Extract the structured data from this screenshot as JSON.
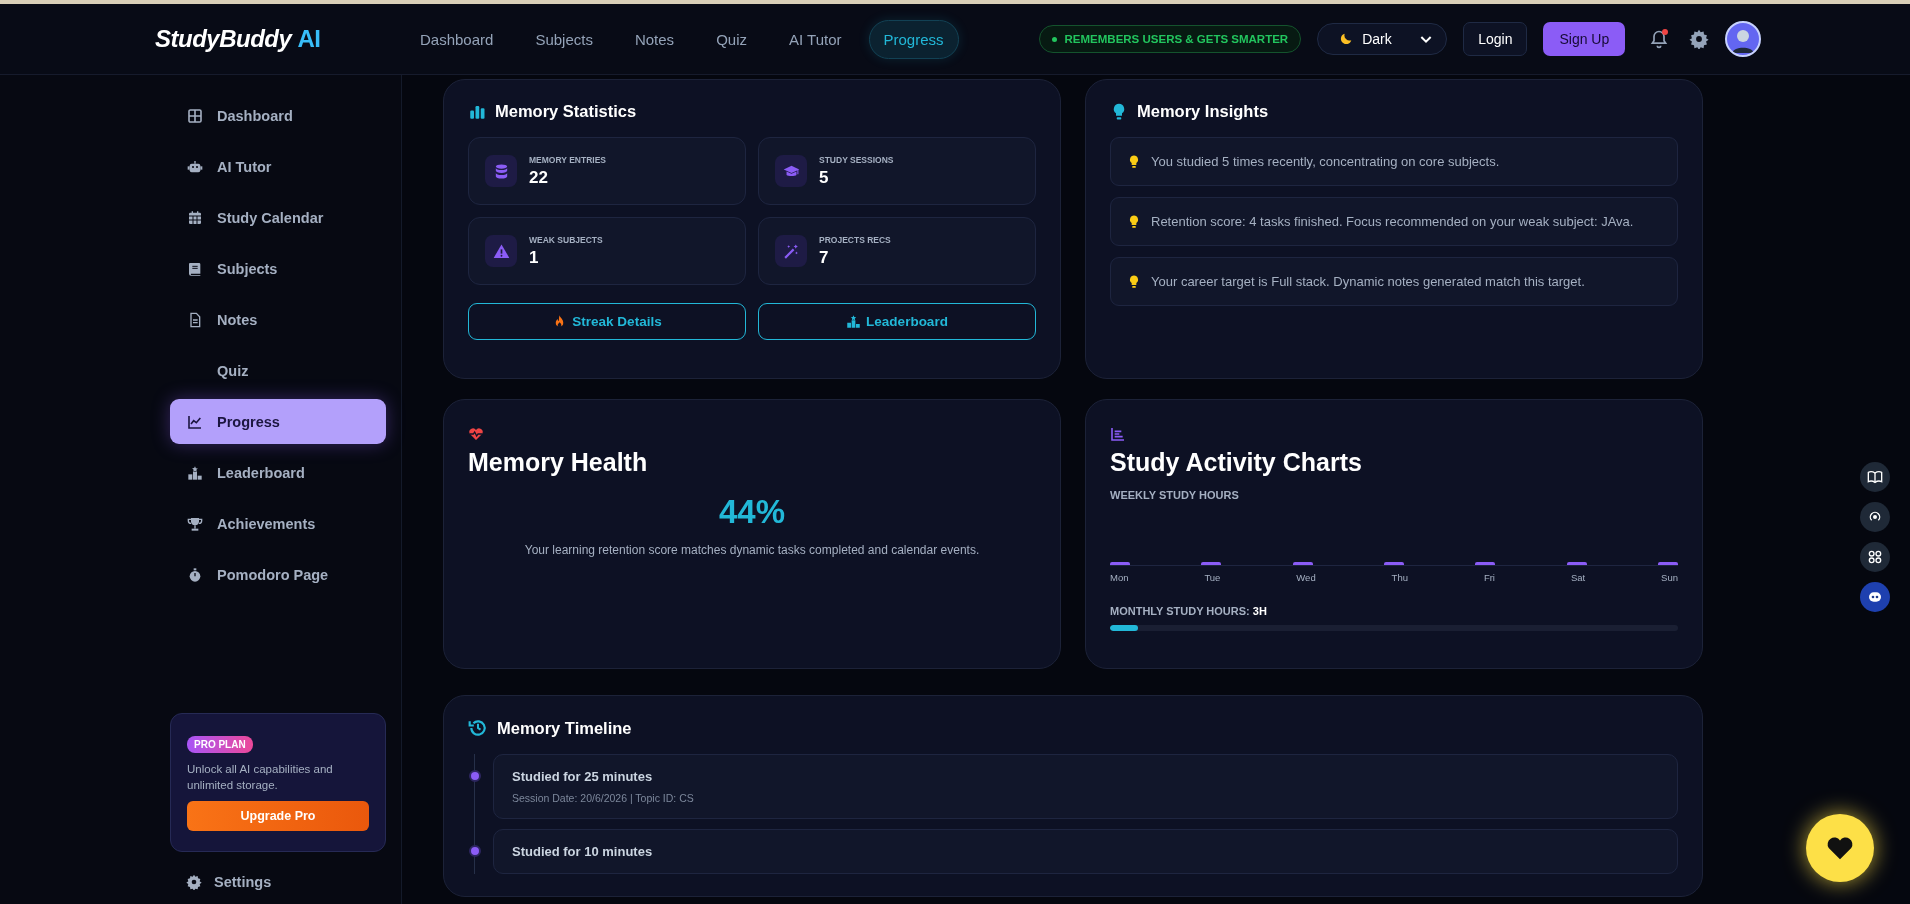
{
  "brand": {
    "name": "StudyBuddy",
    "accent": "AI"
  },
  "nav": [
    {
      "label": "Dashboard",
      "selected": false
    },
    {
      "label": "Subjects",
      "selected": false
    },
    {
      "label": "Notes",
      "selected": false
    },
    {
      "label": "Quiz",
      "selected": false
    },
    {
      "label": "AI Tutor",
      "selected": false
    },
    {
      "label": "Progress",
      "selected": true
    }
  ],
  "memory_badge": "REMEMBERS USERS & GETS SMARTER",
  "theme_select": {
    "value": "Dark"
  },
  "auth": {
    "login": "Login",
    "signup": "Sign Up"
  },
  "notifications": {
    "unread": true
  },
  "sidebar": {
    "items": [
      {
        "label": "Dashboard",
        "selected": false
      },
      {
        "label": "AI Tutor",
        "selected": false
      },
      {
        "label": "Study Calendar",
        "selected": false
      },
      {
        "label": "Subjects",
        "selected": false
      },
      {
        "label": "Notes",
        "selected": false
      },
      {
        "label": "Quiz",
        "selected": false
      },
      {
        "label": "Progress",
        "selected": true
      },
      {
        "label": "Leaderboard",
        "selected": false
      },
      {
        "label": "Achievements",
        "selected": false
      },
      {
        "label": "Pomodoro Page",
        "selected": false
      }
    ],
    "promo": {
      "badge": "PRO PLAN",
      "text": "Unlock all AI capabilities and unlimited storage.",
      "button": "Upgrade Pro"
    },
    "settings": "Settings"
  },
  "memory_statistics": {
    "title": "Memory Statistics",
    "stats": [
      {
        "label": "MEMORY ENTRIES",
        "value": "22"
      },
      {
        "label": "STUDY SESSIONS",
        "value": "5"
      },
      {
        "label": "WEAK SUBJECTS",
        "value": "1"
      },
      {
        "label": "PROJECTS RECS",
        "value": "7"
      }
    ],
    "buttons": [
      "Streak Details",
      "Leaderboard"
    ]
  },
  "memory_insights": {
    "title": "Memory Insights",
    "items": [
      "You studied 5 times recently, concentrating on core subjects.",
      "Retention score: 4 tasks finished. Focus recommended on your weak subject: JAva.",
      "Your career target is Full stack. Dynamic notes generated match this target."
    ]
  },
  "memory_health": {
    "title": "Memory Health",
    "score": "44%",
    "text": "Your learning retention score matches dynamic tasks completed and calendar events."
  },
  "study_activity": {
    "title": "Study Activity Charts",
    "weekly_label": "WEEKLY STUDY HOURS",
    "days": [
      "Mon",
      "Tue",
      "Wed",
      "Thu",
      "Fri",
      "Sat",
      "Sun"
    ],
    "monthly_label": "MONTHLY STUDY HOURS:",
    "monthly_value": "3H",
    "monthly": {
      "level": 0.05
    }
  },
  "memory_timeline": {
    "title": "Memory Timeline",
    "entries": [
      {
        "title": "Studied for 25 minutes",
        "meta": "Session Date: 20/6/2026 | Topic ID: CS"
      },
      {
        "title": "Studied for 10 minutes"
      }
    ]
  }
}
